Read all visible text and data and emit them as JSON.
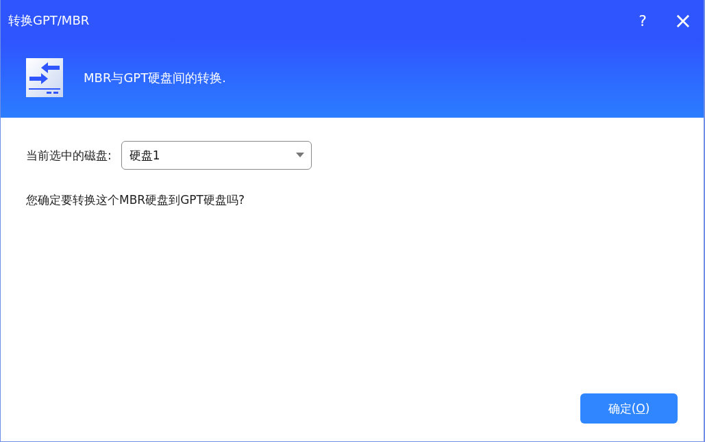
{
  "window": {
    "title": "转换GPT/MBR",
    "help": "?",
    "close": "×"
  },
  "header": {
    "text": "MBR与GPT硬盘间的转换."
  },
  "disk_select": {
    "label": "当前选中的磁盘:",
    "value": "硬盘1"
  },
  "question": "您确定要转换这个MBR硬盘到GPT硬盘吗?",
  "ok_button": {
    "label_before": "确定(",
    "access_key": "O",
    "label_after": ")"
  }
}
